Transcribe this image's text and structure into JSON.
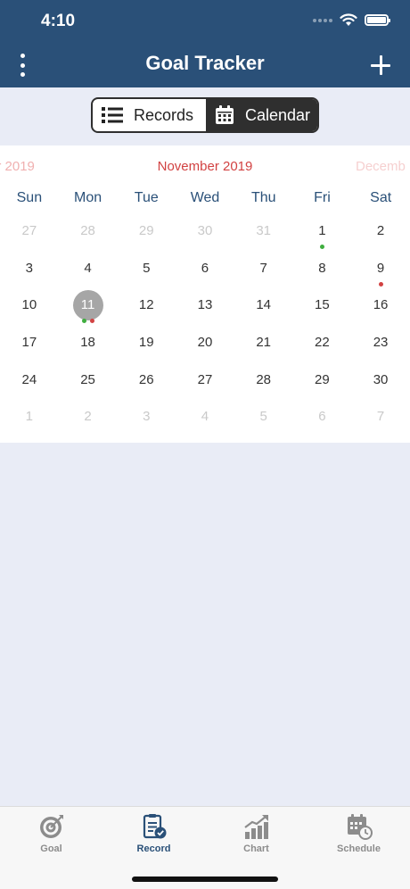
{
  "status_bar": {
    "time": "4:10"
  },
  "header": {
    "title": "Goal Tracker"
  },
  "segment": {
    "records_label": "Records",
    "calendar_label": "Calendar",
    "selected": "Calendar"
  },
  "calendar": {
    "prev_month": "er 2019",
    "current_month": "November 2019",
    "next_month": "Decemb",
    "weekdays": [
      "Sun",
      "Mon",
      "Tue",
      "Wed",
      "Thu",
      "Fri",
      "Sat"
    ],
    "weeks": [
      [
        "27",
        "28",
        "29",
        "30",
        "31",
        "1",
        "2"
      ],
      [
        "3",
        "4",
        "5",
        "6",
        "7",
        "8",
        "9"
      ],
      [
        "10",
        "11",
        "12",
        "13",
        "14",
        "15",
        "16"
      ],
      [
        "17",
        "18",
        "19",
        "20",
        "21",
        "22",
        "23"
      ],
      [
        "24",
        "25",
        "26",
        "27",
        "28",
        "29",
        "30"
      ],
      [
        "1",
        "2",
        "3",
        "4",
        "5",
        "6",
        "7"
      ]
    ],
    "selected_day": "11"
  },
  "tabbar": {
    "tabs": [
      {
        "label": "Goal",
        "icon": "target-icon",
        "active": false
      },
      {
        "label": "Record",
        "icon": "clipboard-check-icon",
        "active": true
      },
      {
        "label": "Chart",
        "icon": "bar-chart-icon",
        "active": false
      },
      {
        "label": "Schedule",
        "icon": "calendar-clock-icon",
        "active": false
      }
    ]
  },
  "colors": {
    "header_bg": "#2a5078",
    "accent_red": "#d24242",
    "dot_green": "#3fae3f",
    "selected_day_bg": "#a6a6a6",
    "page_bg": "#e9ecf6"
  }
}
